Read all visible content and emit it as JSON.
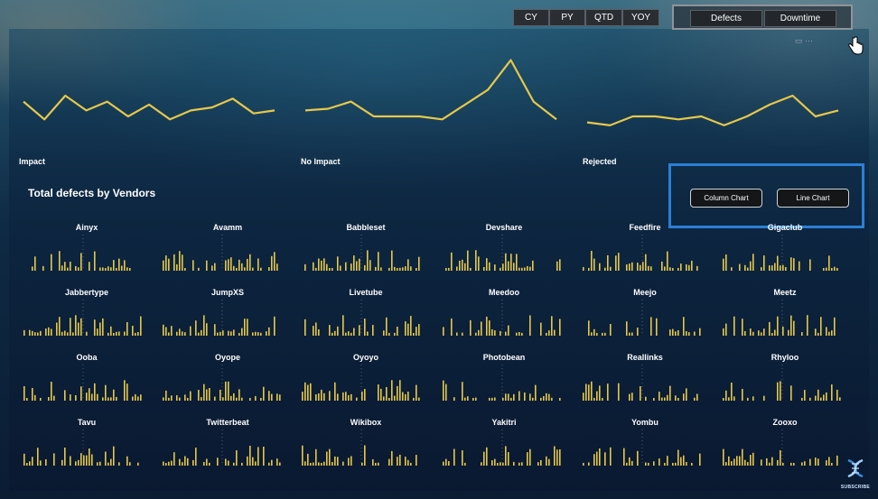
{
  "periods": [
    "CY",
    "PY",
    "QTD",
    "YOY"
  ],
  "metrics": [
    "Defects",
    "Downtime"
  ],
  "sparklines": [
    {
      "label": "Impact",
      "values": [
        6,
        3,
        7,
        4.5,
        6,
        3.5,
        5.5,
        3,
        4.5,
        5,
        6.5,
        4,
        4.5
      ]
    },
    {
      "label": "No Impact",
      "values": [
        4.5,
        4.8,
        6,
        3.5,
        3.5,
        3.5,
        3,
        5.5,
        8,
        13,
        6,
        3
      ]
    },
    {
      "label": "Rejected",
      "values": [
        2.5,
        2,
        3.5,
        3.5,
        3,
        3.5,
        2,
        3.5,
        5.5,
        7,
        3.5,
        4.5
      ]
    }
  ],
  "section_title": "Total defects by Vendors",
  "chart_toggle": {
    "column": "Column Chart",
    "line": "Line Chart"
  },
  "vendors": [
    "Ainyx",
    "Avamm",
    "Babbleset",
    "Devshare",
    "Feedfire",
    "Gigaclub",
    "Jabbertype",
    "JumpXS",
    "Livetube",
    "Meedoo",
    "Meejo",
    "Meetz",
    "Ooba",
    "Oyope",
    "Oyoyo",
    "Photobean",
    "Reallinks",
    "Rhyloo",
    "Tavu",
    "Twitterbeat",
    "Wikibox",
    "Yakitri",
    "Yombu",
    "Zooxo"
  ],
  "subscribe_text": "SUBSCRIBE",
  "colors": {
    "accent": "#e6c84a",
    "highlight": "#2a7fd6"
  }
}
